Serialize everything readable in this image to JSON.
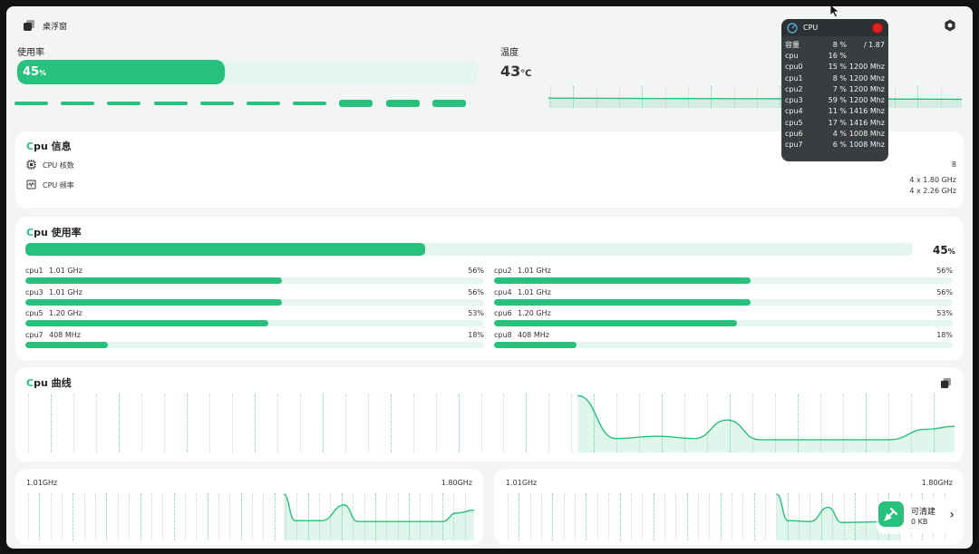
{
  "header": {
    "floating_window_label": "桌浮窗"
  },
  "usage": {
    "label": "使用率",
    "value": "45",
    "unit": "%",
    "fill_fraction": 0.45,
    "dash_levels": [
      0,
      0,
      0,
      0,
      0,
      0,
      0,
      1,
      1,
      1
    ]
  },
  "temperature": {
    "label": "温度",
    "value": "43",
    "unit": "℃"
  },
  "cpu_info": {
    "title_prefix": "C",
    "title_rest": "pu 信息",
    "cores_label": "CPU 核数",
    "cores_value": "8",
    "freq_label": "CPU 频率",
    "freq_values": [
      "4 x 1.80 GHz",
      "4 x 2.26 GHz"
    ]
  },
  "cpu_usage": {
    "title_prefix": "C",
    "title_rest": "pu 使用率",
    "total_value": "45",
    "total_unit": "%",
    "total_fraction": 0.45,
    "cores": [
      {
        "name": "cpu1",
        "freq": "1.01 GHz",
        "pct": "56%",
        "fraction": 0.56
      },
      {
        "name": "cpu2",
        "freq": "1.01 GHz",
        "pct": "56%",
        "fraction": 0.56
      },
      {
        "name": "cpu3",
        "freq": "1.01 GHz",
        "pct": "56%",
        "fraction": 0.56
      },
      {
        "name": "cpu4",
        "freq": "1.01 GHz",
        "pct": "56%",
        "fraction": 0.56
      },
      {
        "name": "cpu5",
        "freq": "1.20 GHz",
        "pct": "53%",
        "fraction": 0.53
      },
      {
        "name": "cpu6",
        "freq": "1.20 GHz",
        "pct": "53%",
        "fraction": 0.53
      },
      {
        "name": "cpu7",
        "freq": "408 MHz",
        "pct": "18%",
        "fraction": 0.18
      },
      {
        "name": "cpu8",
        "freq": "408 MHz",
        "pct": "18%",
        "fraction": 0.18
      }
    ]
  },
  "cpu_curve": {
    "title_prefix": "C",
    "title_rest": "pu 曲线"
  },
  "freq_charts": [
    {
      "left_label": "1.01GHz",
      "right_label": "1.80GHz"
    },
    {
      "left_label": "1.01GHz",
      "right_label": "1.80GHz"
    }
  ],
  "floating_overlay": {
    "title": "CPU",
    "rows": [
      {
        "name": "容量",
        "pct": "8 %",
        "extra": "/ 1.87"
      },
      {
        "name": "cpu",
        "pct": "16 %",
        "extra": ""
      },
      {
        "name": "cpu0",
        "pct": "15 %",
        "extra": "1200 Mhz"
      },
      {
        "name": "cpu1",
        "pct": "8 %",
        "extra": "1200 Mhz"
      },
      {
        "name": "cpu2",
        "pct": "7 %",
        "extra": "1200 Mhz"
      },
      {
        "name": "cpu3",
        "pct": "59 %",
        "extra": "1200 Mhz"
      },
      {
        "name": "cpu4",
        "pct": "11 %",
        "extra": "1416 Mhz"
      },
      {
        "name": "cpu5",
        "pct": "17 %",
        "extra": "1416 Mhz"
      },
      {
        "name": "cpu6",
        "pct": "4 %",
        "extra": "1008 Mhz"
      },
      {
        "name": "cpu7",
        "pct": "6 %",
        "extra": "1008 Mhz"
      }
    ]
  },
  "watermark": {
    "app_name": "可清建",
    "value": "0 KB"
  },
  "colors": {
    "accent": "#27c07d",
    "track": "#e4f6ee",
    "overlay": "#3a3d3f",
    "close": "#e02020"
  }
}
